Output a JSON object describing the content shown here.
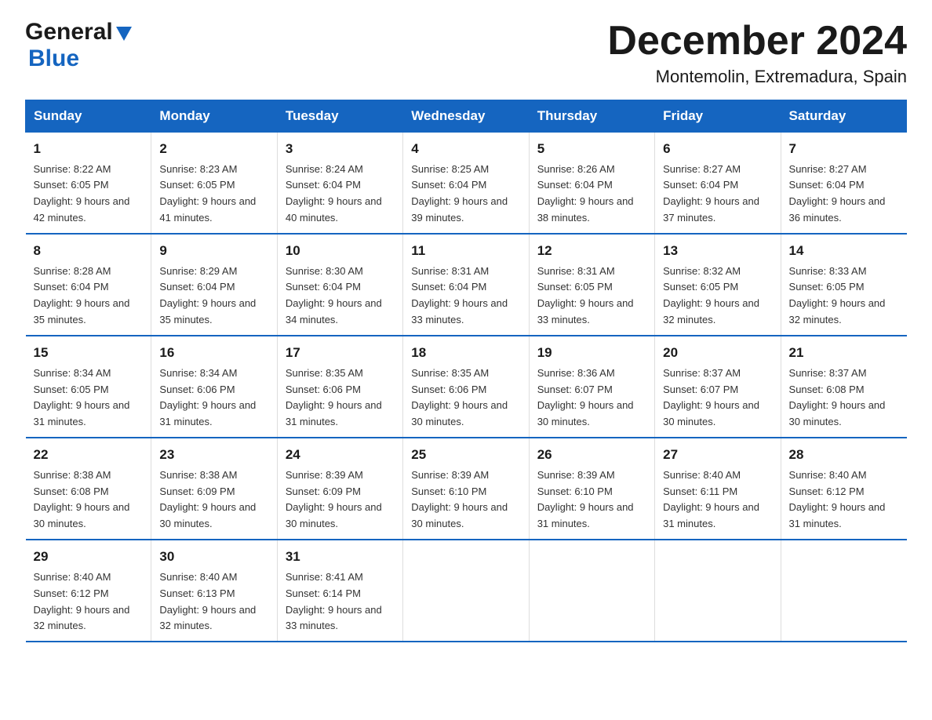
{
  "logo": {
    "text1": "General",
    "text2": "Blue"
  },
  "title": "December 2024",
  "subtitle": "Montemolin, Extremadura, Spain",
  "days_of_week": [
    "Sunday",
    "Monday",
    "Tuesday",
    "Wednesday",
    "Thursday",
    "Friday",
    "Saturday"
  ],
  "weeks": [
    [
      {
        "day": "1",
        "sunrise": "8:22 AM",
        "sunset": "6:05 PM",
        "daylight": "9 hours and 42 minutes."
      },
      {
        "day": "2",
        "sunrise": "8:23 AM",
        "sunset": "6:05 PM",
        "daylight": "9 hours and 41 minutes."
      },
      {
        "day": "3",
        "sunrise": "8:24 AM",
        "sunset": "6:04 PM",
        "daylight": "9 hours and 40 minutes."
      },
      {
        "day": "4",
        "sunrise": "8:25 AM",
        "sunset": "6:04 PM",
        "daylight": "9 hours and 39 minutes."
      },
      {
        "day": "5",
        "sunrise": "8:26 AM",
        "sunset": "6:04 PM",
        "daylight": "9 hours and 38 minutes."
      },
      {
        "day": "6",
        "sunrise": "8:27 AM",
        "sunset": "6:04 PM",
        "daylight": "9 hours and 37 minutes."
      },
      {
        "day": "7",
        "sunrise": "8:27 AM",
        "sunset": "6:04 PM",
        "daylight": "9 hours and 36 minutes."
      }
    ],
    [
      {
        "day": "8",
        "sunrise": "8:28 AM",
        "sunset": "6:04 PM",
        "daylight": "9 hours and 35 minutes."
      },
      {
        "day": "9",
        "sunrise": "8:29 AM",
        "sunset": "6:04 PM",
        "daylight": "9 hours and 35 minutes."
      },
      {
        "day": "10",
        "sunrise": "8:30 AM",
        "sunset": "6:04 PM",
        "daylight": "9 hours and 34 minutes."
      },
      {
        "day": "11",
        "sunrise": "8:31 AM",
        "sunset": "6:04 PM",
        "daylight": "9 hours and 33 minutes."
      },
      {
        "day": "12",
        "sunrise": "8:31 AM",
        "sunset": "6:05 PM",
        "daylight": "9 hours and 33 minutes."
      },
      {
        "day": "13",
        "sunrise": "8:32 AM",
        "sunset": "6:05 PM",
        "daylight": "9 hours and 32 minutes."
      },
      {
        "day": "14",
        "sunrise": "8:33 AM",
        "sunset": "6:05 PM",
        "daylight": "9 hours and 32 minutes."
      }
    ],
    [
      {
        "day": "15",
        "sunrise": "8:34 AM",
        "sunset": "6:05 PM",
        "daylight": "9 hours and 31 minutes."
      },
      {
        "day": "16",
        "sunrise": "8:34 AM",
        "sunset": "6:06 PM",
        "daylight": "9 hours and 31 minutes."
      },
      {
        "day": "17",
        "sunrise": "8:35 AM",
        "sunset": "6:06 PM",
        "daylight": "9 hours and 31 minutes."
      },
      {
        "day": "18",
        "sunrise": "8:35 AM",
        "sunset": "6:06 PM",
        "daylight": "9 hours and 30 minutes."
      },
      {
        "day": "19",
        "sunrise": "8:36 AM",
        "sunset": "6:07 PM",
        "daylight": "9 hours and 30 minutes."
      },
      {
        "day": "20",
        "sunrise": "8:37 AM",
        "sunset": "6:07 PM",
        "daylight": "9 hours and 30 minutes."
      },
      {
        "day": "21",
        "sunrise": "8:37 AM",
        "sunset": "6:08 PM",
        "daylight": "9 hours and 30 minutes."
      }
    ],
    [
      {
        "day": "22",
        "sunrise": "8:38 AM",
        "sunset": "6:08 PM",
        "daylight": "9 hours and 30 minutes."
      },
      {
        "day": "23",
        "sunrise": "8:38 AM",
        "sunset": "6:09 PM",
        "daylight": "9 hours and 30 minutes."
      },
      {
        "day": "24",
        "sunrise": "8:39 AM",
        "sunset": "6:09 PM",
        "daylight": "9 hours and 30 minutes."
      },
      {
        "day": "25",
        "sunrise": "8:39 AM",
        "sunset": "6:10 PM",
        "daylight": "9 hours and 30 minutes."
      },
      {
        "day": "26",
        "sunrise": "8:39 AM",
        "sunset": "6:10 PM",
        "daylight": "9 hours and 31 minutes."
      },
      {
        "day": "27",
        "sunrise": "8:40 AM",
        "sunset": "6:11 PM",
        "daylight": "9 hours and 31 minutes."
      },
      {
        "day": "28",
        "sunrise": "8:40 AM",
        "sunset": "6:12 PM",
        "daylight": "9 hours and 31 minutes."
      }
    ],
    [
      {
        "day": "29",
        "sunrise": "8:40 AM",
        "sunset": "6:12 PM",
        "daylight": "9 hours and 32 minutes."
      },
      {
        "day": "30",
        "sunrise": "8:40 AM",
        "sunset": "6:13 PM",
        "daylight": "9 hours and 32 minutes."
      },
      {
        "day": "31",
        "sunrise": "8:41 AM",
        "sunset": "6:14 PM",
        "daylight": "9 hours and 33 minutes."
      },
      null,
      null,
      null,
      null
    ]
  ]
}
